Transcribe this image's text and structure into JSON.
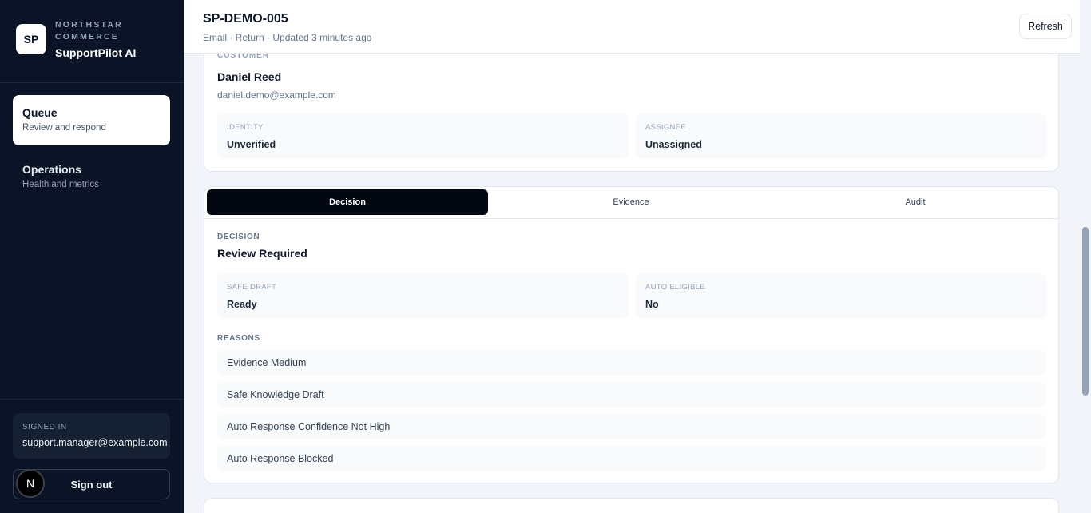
{
  "brand": {
    "logo": "SP",
    "company": "NORTHSTAR COMMERCE",
    "app": "SupportPilot AI"
  },
  "nav": [
    {
      "label": "Queue",
      "sub": "Review and respond"
    },
    {
      "label": "Operations",
      "sub": "Health and metrics"
    }
  ],
  "account": {
    "signed_label": "SIGNED IN",
    "email": "support.manager@example.com",
    "signout": "Sign out",
    "badge": "N"
  },
  "header": {
    "ticket_id": "SP-DEMO-005",
    "meta": "Email · Return · Updated 3 minutes ago",
    "refresh": "Refresh"
  },
  "customer": {
    "label": "CUSTOMER",
    "name": "Daniel Reed",
    "email": "daniel.demo@example.com",
    "identity_label": "IDENTITY",
    "identity": "Unverified",
    "assignee_label": "ASSIGNEE",
    "assignee": "Unassigned"
  },
  "tabs": [
    "Decision",
    "Evidence",
    "Audit"
  ],
  "decision": {
    "label": "DECISION",
    "value": "Review Required",
    "safe_draft_label": "SAFE DRAFT",
    "safe_draft": "Ready",
    "auto_eligible_label": "AUTO ELIGIBLE",
    "auto_eligible": "No",
    "reasons_label": "REASONS",
    "reasons": [
      "Evidence Medium",
      "Safe Knowledge Draft",
      "Auto Response Confidence Not High",
      "Auto Response Blocked"
    ]
  }
}
